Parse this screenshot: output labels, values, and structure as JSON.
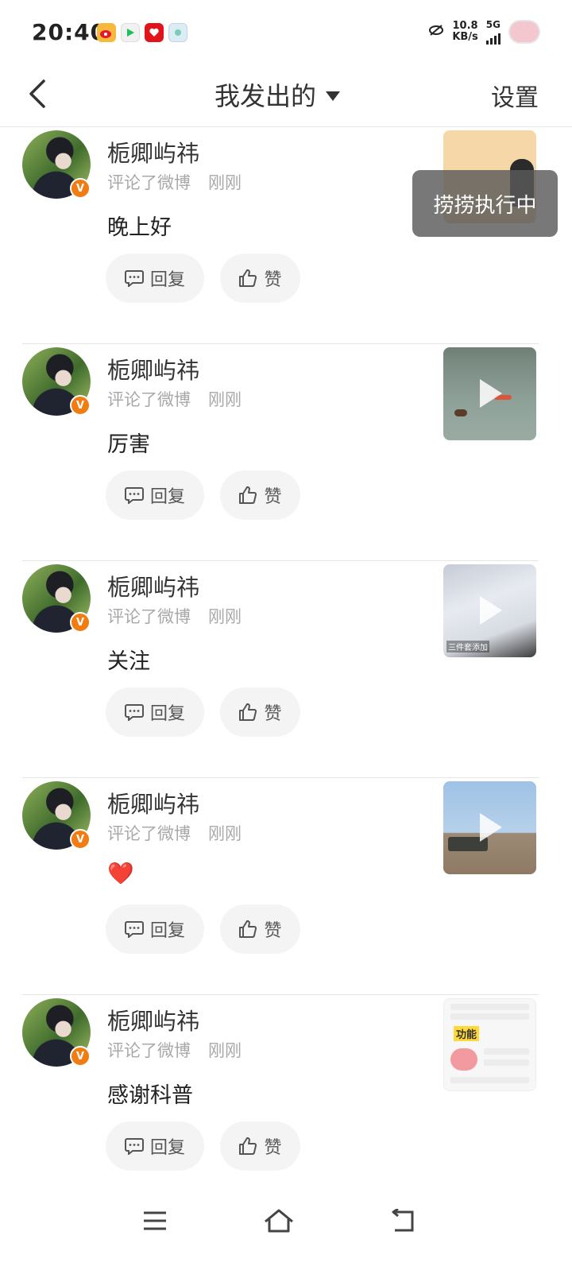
{
  "status_bar": {
    "time": "20:40",
    "app_icons": [
      "weibo-icon",
      "video-app-icon",
      "red-app-icon",
      "gallery-app-icon"
    ],
    "net_speed_value": "10.8",
    "net_speed_unit": "KB/s",
    "network_type": "5G"
  },
  "header": {
    "title": "我发出的",
    "settings_label": "设置"
  },
  "toast": {
    "text": "捞捞执行中"
  },
  "items": [
    {
      "username": "栀卿屿祎",
      "action": "评论了微博",
      "time": "刚刚",
      "content": "晚上好",
      "reply_label": "回复",
      "like_label": "赞",
      "badge": "V"
    },
    {
      "username": "栀卿屿祎",
      "action": "评论了微博",
      "time": "刚刚",
      "content": "厉害",
      "reply_label": "回复",
      "like_label": "赞",
      "badge": "V"
    },
    {
      "username": "栀卿屿祎",
      "action": "评论了微博",
      "time": "刚刚",
      "content": "关注",
      "reply_label": "回复",
      "like_label": "赞",
      "badge": "V"
    },
    {
      "username": "栀卿屿祎",
      "action": "评论了微博",
      "time": "刚刚",
      "content": "❤️",
      "reply_label": "回复",
      "like_label": "赞",
      "badge": "V"
    },
    {
      "username": "栀卿屿祎",
      "action": "评论了微博",
      "time": "刚刚",
      "content": "感谢科普",
      "reply_label": "回复",
      "like_label": "赞",
      "badge": "V"
    }
  ],
  "thumbs": {
    "thumb3_caption": "三件套添加",
    "thumb5_tag": "功能"
  },
  "colors": {
    "accent": "#f07c12",
    "toast_bg": "#5a5a5a",
    "pill_bg": "#f4f4f4",
    "meta_text": "#a8a8a8"
  },
  "navbar": {
    "icons": [
      "menu-icon",
      "home-icon",
      "back-nav-icon"
    ]
  }
}
